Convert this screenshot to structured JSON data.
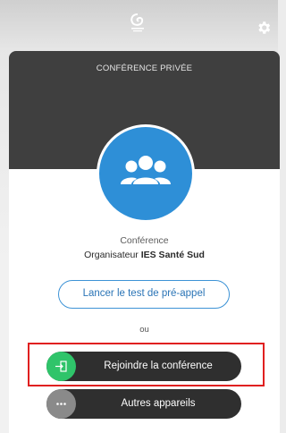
{
  "header": {
    "logo_icon": "brand-logo-icon",
    "settings_icon": "gear-icon"
  },
  "card": {
    "title": "CONFÉRENCE PRIVÉE",
    "avatar_icon": "group-icon",
    "conference_label": "Conférence",
    "organizer_prefix": "Organisateur",
    "organizer_name": "IES Santé Sud",
    "test_button_label": "Lancer le test de pré-appel",
    "or_label": "ou",
    "join_button_label": "Rejoindre la conférence",
    "join_icon": "enter-icon",
    "other_devices_label": "Autres appareils",
    "other_devices_icon": "more-icon"
  },
  "colors": {
    "header_dark": "#3f3f3f",
    "avatar_blue": "#2e8fd7",
    "join_green": "#2fc46a",
    "other_gray": "#8a8a8a",
    "outline_blue": "#3d93d6",
    "highlight_red": "#e02020"
  }
}
